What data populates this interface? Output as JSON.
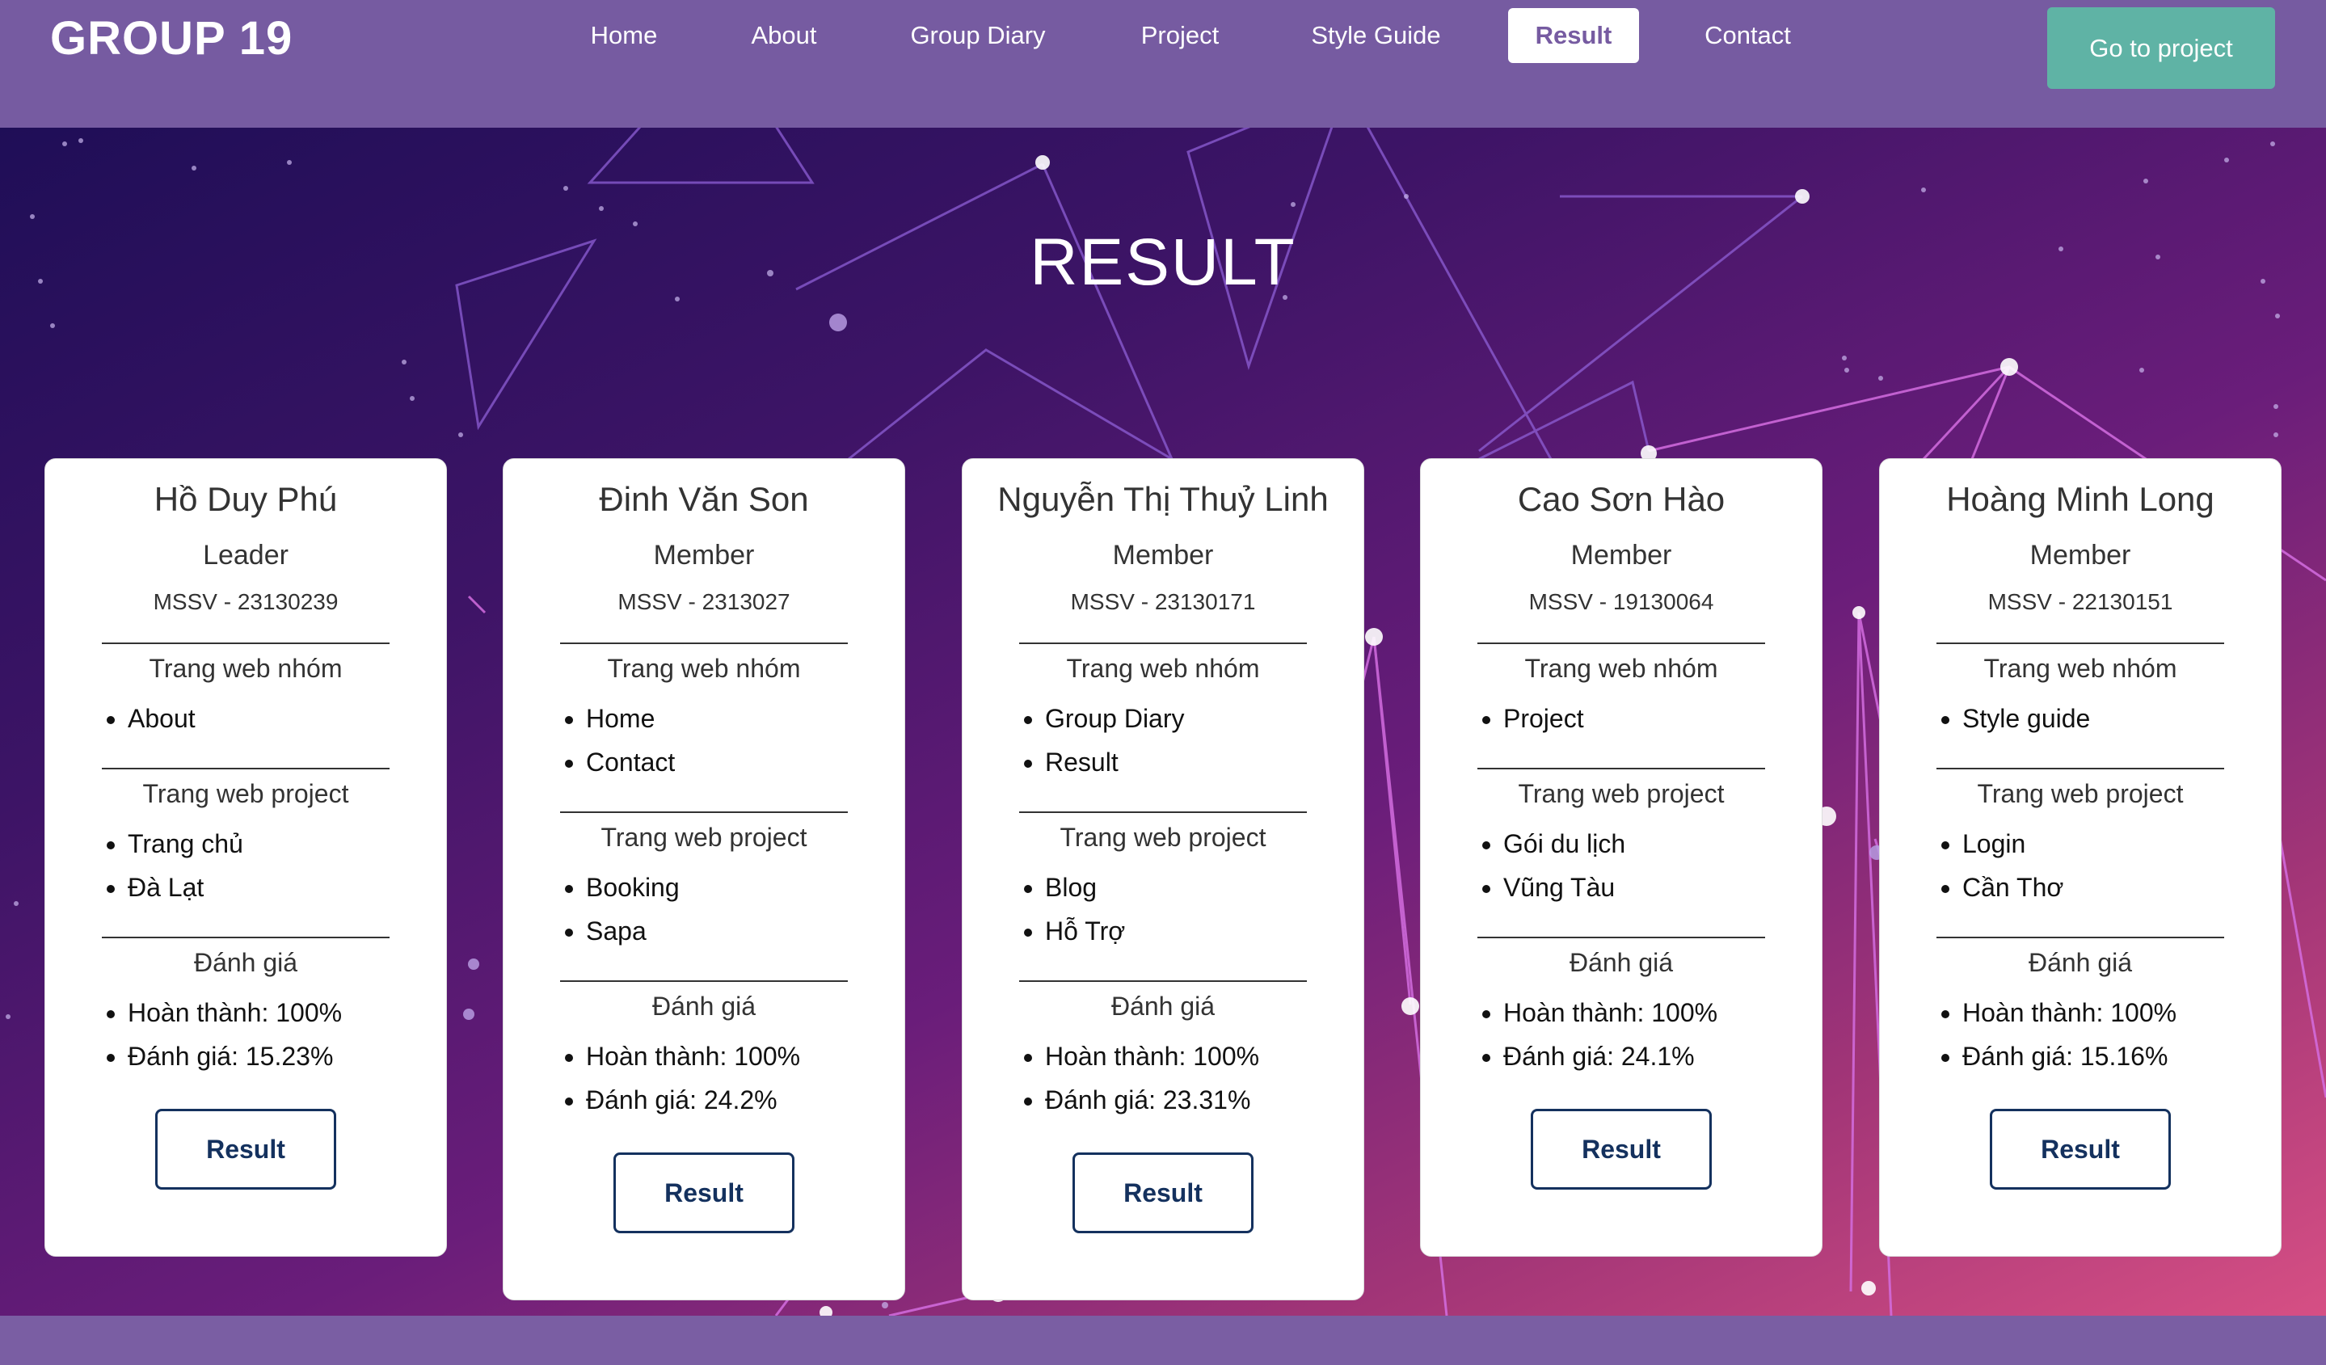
{
  "header": {
    "brand": "GROUP 19",
    "nav": [
      "Home",
      "About",
      "Group Diary",
      "Project",
      "Style Guide",
      "Result",
      "Contact"
    ],
    "active": "Result",
    "cta": "Go to project"
  },
  "hero": {
    "title": "RESULT"
  },
  "cards": [
    {
      "name": "Hồ Duy Phú",
      "role": "Leader",
      "mssv": "MSSV - 23130239",
      "group_title": "Trang web nhóm",
      "group_items": [
        "About"
      ],
      "project_title": "Trang web project",
      "project_items": [
        "Trang chủ",
        "Đà Lạt"
      ],
      "eval_title": "Đánh giá",
      "eval_items": [
        "Hoàn thành: 100%",
        "Đánh giá: 15.23%"
      ],
      "button": "Result"
    },
    {
      "name": "Đinh Văn Son",
      "role": "Member",
      "mssv": "MSSV - 2313027",
      "group_title": "Trang web nhóm",
      "group_items": [
        "Home",
        "Contact"
      ],
      "project_title": "Trang web project",
      "project_items": [
        "Booking",
        "Sapa"
      ],
      "eval_title": "Đánh giá",
      "eval_items": [
        "Hoàn thành: 100%",
        "Đánh giá: 24.2%"
      ],
      "button": "Result"
    },
    {
      "name": "Nguyễn Thị Thuỷ Linh",
      "role": "Member",
      "mssv": "MSSV - 23130171",
      "group_title": "Trang web nhóm",
      "group_items": [
        "Group Diary",
        "Result"
      ],
      "project_title": "Trang web project",
      "project_items": [
        "Blog",
        "Hỗ Trợ"
      ],
      "eval_title": "Đánh giá",
      "eval_items": [
        "Hoàn thành: 100%",
        "Đánh giá: 23.31%"
      ],
      "button": "Result"
    },
    {
      "name": "Cao Sơn Hào",
      "role": "Member",
      "mssv": "MSSV - 19130064",
      "group_title": "Trang web nhóm",
      "group_items": [
        "Project"
      ],
      "project_title": "Trang web project",
      "project_items": [
        "Gói du lịch",
        "Vũng Tàu"
      ],
      "eval_title": "Đánh giá",
      "eval_items": [
        "Hoàn thành: 100%",
        "Đánh giá: 24.1%"
      ],
      "button": "Result"
    },
    {
      "name": "Hoàng Minh Long",
      "role": "Member",
      "mssv": "MSSV - 22130151",
      "group_title": "Trang web nhóm",
      "group_items": [
        "Style guide"
      ],
      "project_title": "Trang web project",
      "project_items": [
        "Login",
        "Cần Thơ"
      ],
      "eval_title": "Đánh giá",
      "eval_items": [
        "Hoàn thành: 100%",
        "Đánh giá: 15.16%"
      ],
      "button": "Result"
    }
  ],
  "colors": {
    "header_bg": "#765ba1",
    "active_tab_text": "#765ba1",
    "cta_bg": "#5fb3a5",
    "button_border": "#14315e",
    "hero_gradient_start": "#1f0e57",
    "hero_gradient_end": "#d64f84"
  }
}
